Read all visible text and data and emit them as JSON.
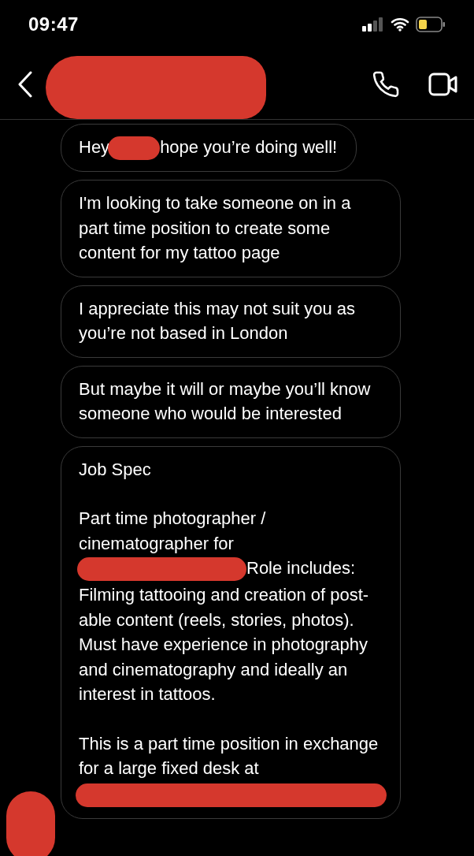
{
  "status_bar": {
    "time": "09:47"
  },
  "messages": [
    {
      "paragraphs": [
        [
          {
            "kind": "text",
            "text": "Hey"
          },
          {
            "kind": "redaction"
          },
          {
            "kind": "text",
            "text": "hope you’re doing well!"
          }
        ]
      ]
    },
    {
      "paragraphs": [
        [
          {
            "kind": "text",
            "text": "I'm looking to take someone on in a part time position to create some content for my tattoo page"
          }
        ]
      ]
    },
    {
      "paragraphs": [
        [
          {
            "kind": "text",
            "text": "I appreciate this may not suit you as you’re not based in London"
          }
        ]
      ]
    },
    {
      "paragraphs": [
        [
          {
            "kind": "text",
            "text": "But maybe it will or maybe you’ll know someone who would be interested"
          }
        ]
      ]
    },
    {
      "paragraphs": [
        [
          {
            "kind": "text",
            "text": "Job Spec"
          }
        ],
        [
          {
            "kind": "line",
            "text": "Part time photographer / cinematographer for"
          },
          {
            "kind": "redaction"
          },
          {
            "kind": "text",
            "text": "Role includes:"
          },
          {
            "kind": "line",
            "text": "Filming tattooing and creation of post-able content (reels, stories, photos). Must have experience in photography and cinematography and ideally an interest in tattoos."
          }
        ],
        [
          {
            "kind": "line",
            "text": "This is a part time position in exchange for a large fixed desk at"
          },
          {
            "kind": "redaction"
          }
        ]
      ]
    }
  ]
}
